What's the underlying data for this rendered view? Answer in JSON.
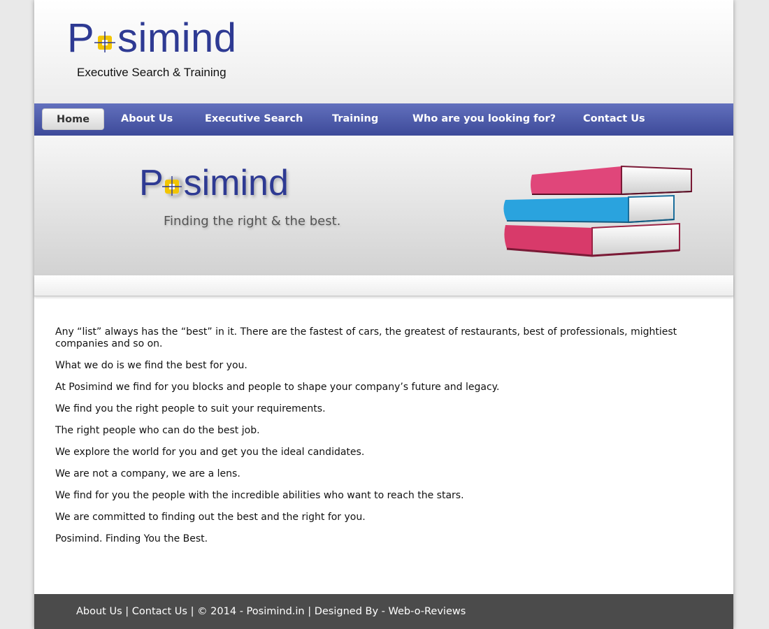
{
  "header": {
    "logo_text": "Posimind",
    "tagline": "Executive Search & Training"
  },
  "nav": {
    "items": [
      {
        "label": "Home"
      },
      {
        "label": "About Us"
      },
      {
        "label": "Executive Search"
      },
      {
        "label": "Training"
      },
      {
        "label": "Who are you looking for?"
      },
      {
        "label": "Contact Us"
      }
    ]
  },
  "banner": {
    "logo_text": "Posimind",
    "tagline": "Finding the right & the best."
  },
  "content": {
    "paragraphs": [
      "Any “list” always has the “best” in it. There are the fastest of cars, the greatest of restaurants, best of professionals, mightiest companies and so on.",
      "What we do is we find the best for you.",
      "At Posimind we find for you blocks and people to shape your company’s future and legacy.",
      "We find you the right people to suit your requirements.",
      "The right people who can do the best job.",
      "We explore the world for you and get you the ideal candidates.",
      "We are not a company, we are a lens.",
      "We find for you the people with the incredible abilities who want to reach the stars.",
      "We are committed to finding out the best and the right for you.",
      "Posimind. Finding You the Best."
    ]
  },
  "footer": {
    "about_link": "About Us",
    "sep1": " | ",
    "contact_link": "Contact Us",
    "sep2": " | ",
    "copyright": "© 2014 - Posimind.in",
    "sep3": " | ",
    "designed_by": "Designed By - ",
    "designer_link": "Web-o-Reviews"
  },
  "colors": {
    "brand_blue": "#2e3a93",
    "brand_yellow": "#f2c500",
    "nav_bg": "#4b58a6",
    "footer_bg": "#4b4b4b"
  },
  "icons": {
    "logo_o": "crosshair-square-icon",
    "books": "stacked-books-icon"
  }
}
